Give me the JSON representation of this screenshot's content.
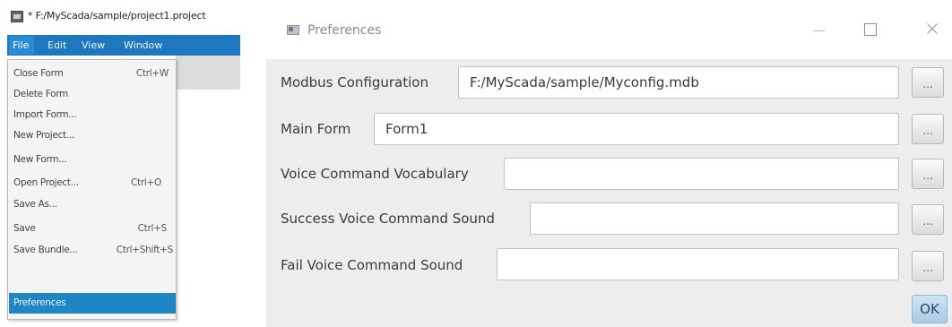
{
  "ide": {
    "title": "* F:/MyScada/sample/project1.project",
    "menubar": [
      "File",
      "Edit",
      "View",
      "Window"
    ],
    "file_menu": [
      {
        "label": "Close Form",
        "shortcut": "Ctrl+W"
      },
      {
        "label": "Delete Form",
        "shortcut": ""
      },
      {
        "label": "Import Form...",
        "shortcut": ""
      },
      {
        "label": "New Project...",
        "shortcut": ""
      },
      {
        "label": "New Form...",
        "shortcut": ""
      },
      {
        "label": "Open Project...",
        "shortcut": "Ctrl+O"
      },
      {
        "label": "Save As...",
        "shortcut": ""
      },
      {
        "label": "Save",
        "shortcut": "Ctrl+S"
      },
      {
        "label": "Save Bundle...",
        "shortcut": "Ctrl+Shift+S"
      },
      {
        "label": "Preferences",
        "shortcut": ""
      }
    ],
    "selected_item": "Preferences"
  },
  "dialog": {
    "title": "Preferences",
    "fields": [
      {
        "label": "Modbus Configuration",
        "value": "F:/MyScada/sample/Myconfig.mdb",
        "browse_label": "..."
      },
      {
        "label": "Main Form",
        "value": "Form1",
        "browse_label": "..."
      },
      {
        "label": "Voice Command Vocabulary",
        "value": "",
        "browse_label": "..."
      },
      {
        "label": "Success Voice Command Sound",
        "value": "",
        "browse_label": "..."
      },
      {
        "label": "Fail Voice Command Sound",
        "value": "",
        "browse_label": "..."
      }
    ],
    "ok_label": "OK",
    "close_symbol": "×"
  },
  "colors": {
    "menubar": "#1e78bf",
    "selection": "#1f86c6",
    "ok_button": "#b9d6ee"
  }
}
